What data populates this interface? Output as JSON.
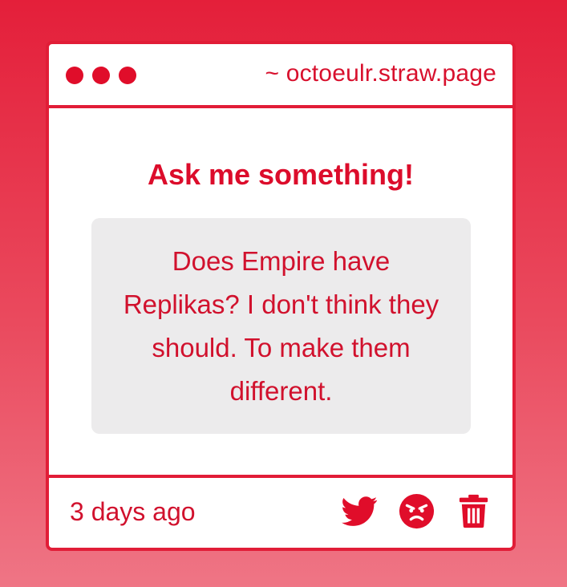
{
  "window": {
    "url": "~ octoeulr.straw.page"
  },
  "content": {
    "heading": "Ask me something!",
    "question": "Does Empire have Replikas? I don't think they should. To make them different."
  },
  "footer": {
    "timestamp": "3 days ago",
    "actions": [
      {
        "icon": "twitter-icon"
      },
      {
        "icon": "angry-face-icon"
      },
      {
        "icon": "trash-icon"
      }
    ]
  },
  "colors": {
    "accent": "#e11d37",
    "text": "#d1112d",
    "question_bg": "#ecebec"
  }
}
